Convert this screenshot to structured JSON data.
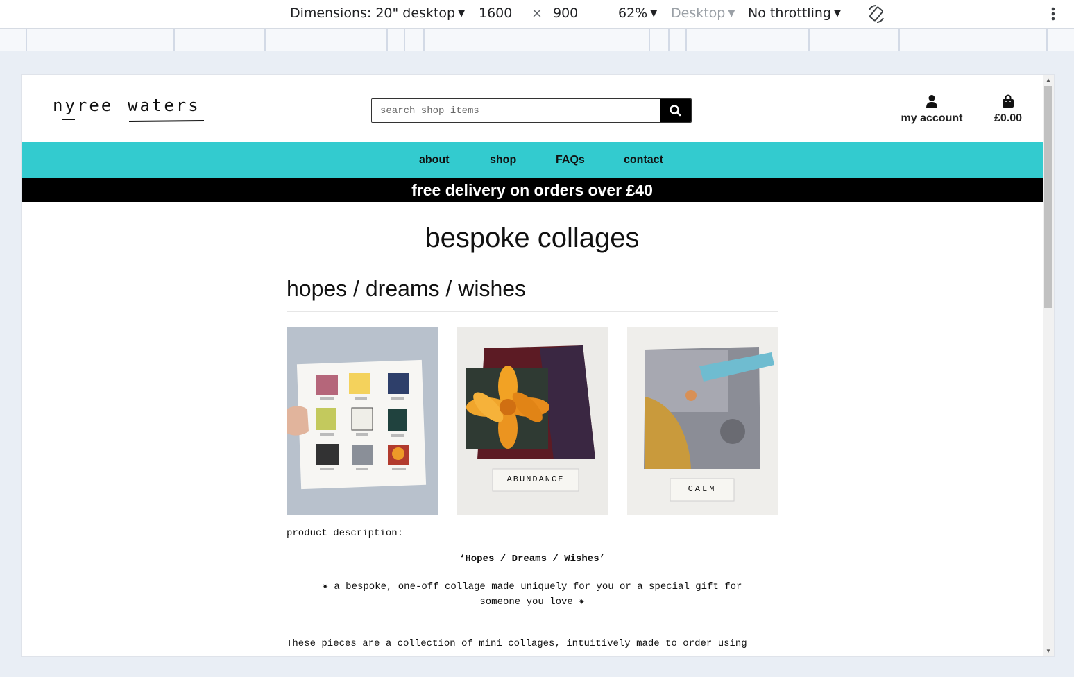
{
  "devtools": {
    "device_label": "Dimensions: 20\" desktop",
    "width": "1600",
    "times": "×",
    "height": "900",
    "zoom": "62%",
    "device_type": "Desktop",
    "throttling": "No throttling"
  },
  "site": {
    "logo_first": "nyree",
    "logo_second": "waters",
    "search_placeholder": "search shop items",
    "account_label": "my account",
    "cart_total": "£0.00"
  },
  "nav": {
    "items": [
      "about",
      "shop",
      "FAQs",
      "contact"
    ],
    "accent_color": "#33cbcf"
  },
  "banner": {
    "text": "free delivery on orders over £40"
  },
  "product": {
    "page_title": "bespoke collages",
    "title": "hopes / dreams / wishes",
    "image_labels": [
      "ABUNDANCE",
      "CALM"
    ],
    "description_label": "product description:",
    "quote": "‘Hopes / Dreams / Wishes’",
    "tagline": "✷ a bespoke, one-off collage made uniquely for you or a special gift for someone you love ✷",
    "paragraph": "These pieces are a collection of mini collages, intuitively made to order using"
  }
}
